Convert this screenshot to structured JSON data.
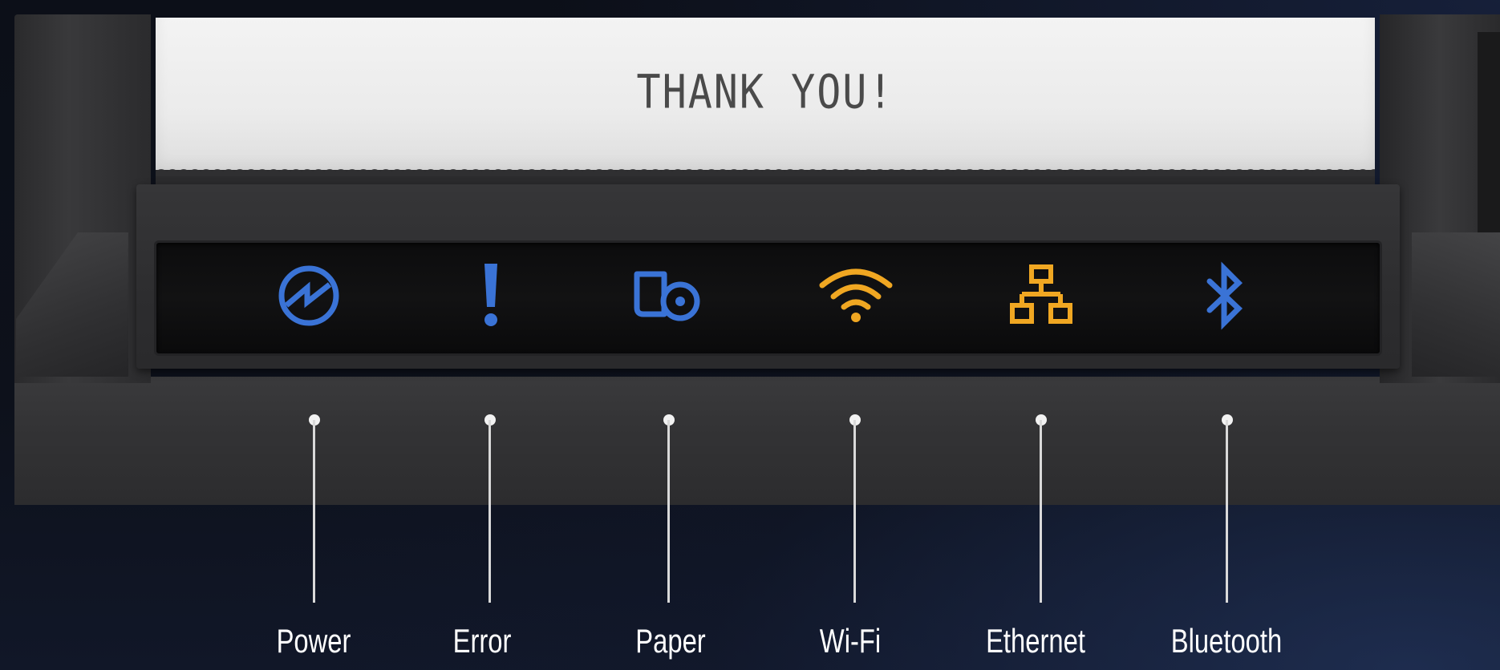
{
  "paper": {
    "message": "THANK YOU!"
  },
  "colors": {
    "blue": "#3a73d6",
    "amber": "#f0a722",
    "label": "#ffffff"
  },
  "indicators": [
    {
      "label": "Power",
      "icon": "power-icon",
      "color": "#3a73d6"
    },
    {
      "label": "Error",
      "icon": "exclamation-icon",
      "color": "#3a73d6"
    },
    {
      "label": "Paper",
      "icon": "paper-roll-icon",
      "color": "#3a73d6"
    },
    {
      "label": "Wi-Fi",
      "icon": "wifi-icon",
      "color": "#f0a722"
    },
    {
      "label": "Ethernet",
      "icon": "network-icon",
      "color": "#f0a722"
    },
    {
      "label": "Bluetooth",
      "icon": "bluetooth-icon",
      "color": "#3a73d6"
    }
  ]
}
